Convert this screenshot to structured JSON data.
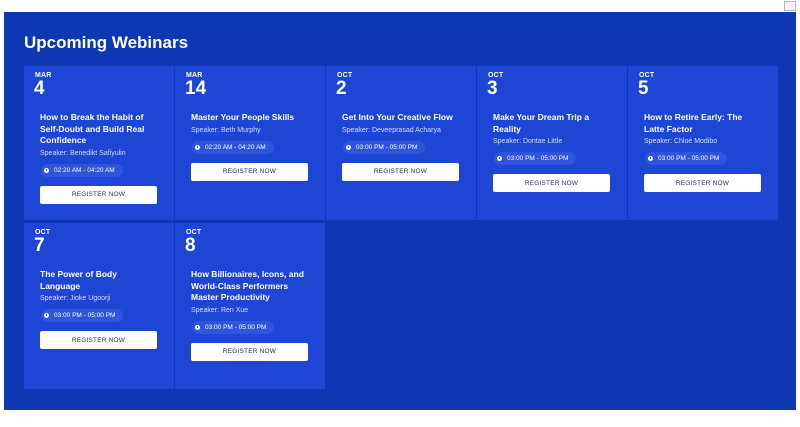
{
  "heading": "Upcoming Webinars",
  "colors": {
    "panel": "#0e37b3",
    "card": "#1e45d4",
    "pill": "#2f55dd",
    "button": "#ffffff"
  },
  "webinars": [
    {
      "month": "MAR",
      "day": "4",
      "title": "How to Break the Habit of Self-Doubt and Build Real Confidence",
      "speaker": "Speaker: Benedikt Safiyulin",
      "time": "02:20 AM - 04:20 AM",
      "button": "REGISTER NOW"
    },
    {
      "month": "MAR",
      "day": "14",
      "title": "Master Your People Skills",
      "speaker": "Speaker: Beth Murphy",
      "time": "02:20 AM - 04:20 AM",
      "button": "REGISTER NOW"
    },
    {
      "month": "OCT",
      "day": "2",
      "title": "Get Into Your Creative Flow",
      "speaker": "Speaker: Deveeprasad Acharya",
      "time": "03:00 PM - 05:00 PM",
      "button": "REGISTER NOW"
    },
    {
      "month": "OCT",
      "day": "3",
      "title": "Make Your Dream Trip a Reality",
      "speaker": "Speaker: Dontae Little",
      "time": "03:00 PM - 05:00 PM",
      "button": "REGISTER NOW"
    },
    {
      "month": "OCT",
      "day": "5",
      "title": "How to Retire Early: The Latte Factor",
      "speaker": "Speaker: Chloé Modibo",
      "time": "03:00 PM - 05:00 PM",
      "button": "REGISTER NOW"
    },
    {
      "month": "OCT",
      "day": "7",
      "title": "The Power of Body Language",
      "speaker": "Speaker: Jioke Ugoorji",
      "time": "03:00 PM - 05:00 PM",
      "button": "REGISTER NOW"
    },
    {
      "month": "OCT",
      "day": "8",
      "title": "How Billionaires, Icons, and World-Class Performers Master Productivity",
      "speaker": "Speaker: Ren Xue",
      "time": "03:00 PM - 05:00 PM",
      "button": "REGISTER NOW"
    }
  ]
}
